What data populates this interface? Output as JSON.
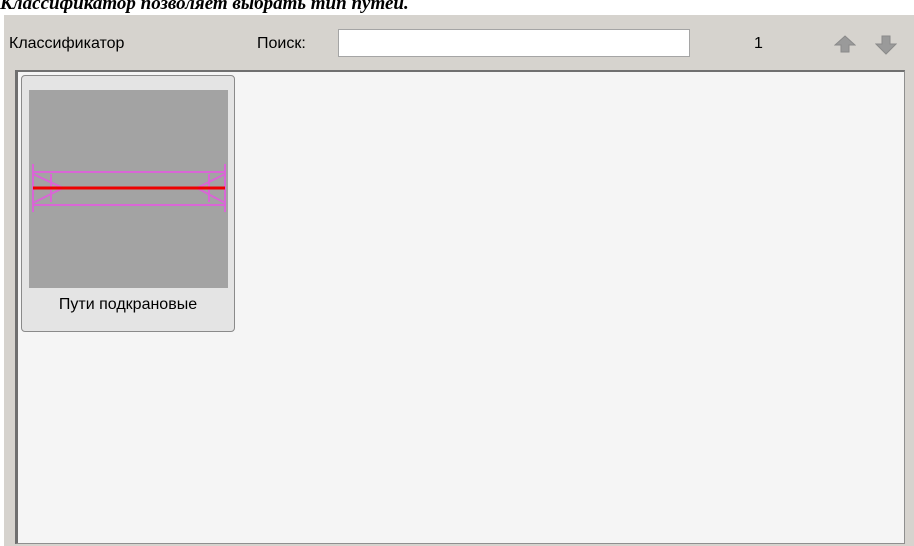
{
  "caption": "Классификатор позволяет выбрать тип путей.",
  "toolbar": {
    "classifier_label": "Классификатор",
    "search_label": "Поиск:",
    "search_value": "",
    "page_number": "1",
    "up_icon": "arrow-up-icon",
    "down_icon": "arrow-down-icon"
  },
  "items": [
    {
      "label": "Пути подкрановые",
      "icon": "crane-rails-thumbnail"
    }
  ],
  "colors": {
    "panel_bg": "#d6d3ce",
    "list_bg": "#f5f5f5",
    "thumb_bg": "#a3a3a3",
    "rail_magenta": "#d966d6",
    "rail_red": "#ee0000"
  }
}
